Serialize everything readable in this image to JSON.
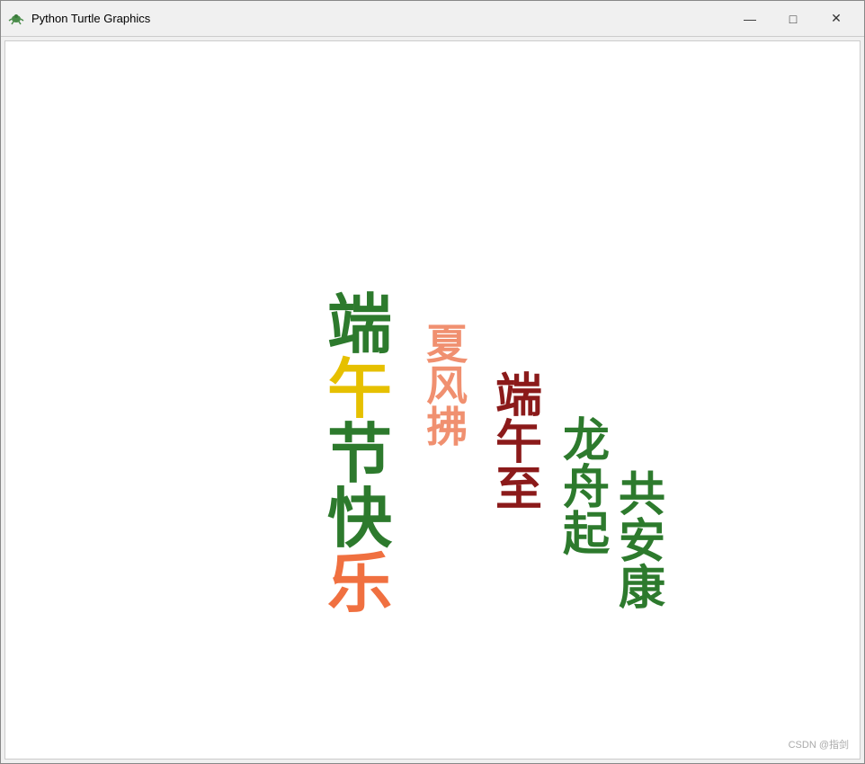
{
  "window": {
    "title": "Python Turtle Graphics",
    "icon": "turtle-icon"
  },
  "controls": {
    "minimize": "—",
    "maximize": "□",
    "close": "✕"
  },
  "content": {
    "group1": {
      "chars": [
        "端",
        "午",
        "节",
        "快",
        "乐"
      ]
    },
    "group2": {
      "chars": [
        "夏",
        "风",
        "拂"
      ]
    },
    "group3": {
      "chars": [
        "端",
        "午",
        "至"
      ]
    },
    "group4": {
      "chars": [
        "龙",
        "舟",
        "起"
      ]
    },
    "group5": {
      "chars": [
        "共",
        "安",
        "康"
      ]
    },
    "watermark": "CSDN @指剑"
  }
}
